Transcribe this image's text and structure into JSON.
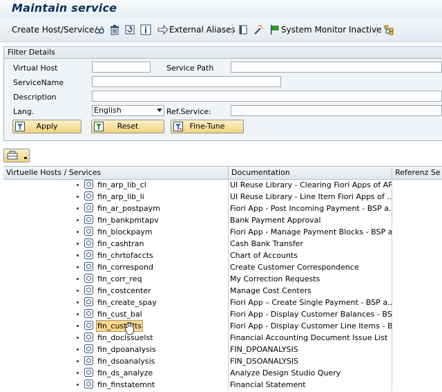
{
  "window": {
    "title": "Maintain service"
  },
  "toolbar": {
    "create_host_label": "Create Host/Service",
    "external_aliases_label": "External Aliases",
    "system_monitor_label": "System Monitor Inactive"
  },
  "filter": {
    "header": "Filter Details",
    "virtual_host_label": "Virtual Host",
    "virtual_host_value": "",
    "service_path_label": "Service Path",
    "service_path_value": "",
    "service_name_label": "ServiceName",
    "service_name_value": "",
    "description_label": "Description",
    "description_value": "",
    "lang_label": "Lang.",
    "lang_value": "English",
    "ref_service_label": "Ref.Service:",
    "ref_service_value": "",
    "apply_label": "Apply",
    "reset_label": "Reset",
    "fine_tune_label": "Fine-Tune"
  },
  "table": {
    "columns": [
      "Virtuelle Hosts / Services",
      "Documentation",
      "Referenz Se"
    ],
    "rows": [
      {
        "name": "fin_arp_lib_cl",
        "doc": "UI Reuse Library - Clearing Fiori Apps of AP..."
      },
      {
        "name": "fin_arp_lib_li",
        "doc": "UI Reuse Library - Line Item Fiori Apps of ..."
      },
      {
        "name": "fin_ar_postpaym",
        "doc": "Fiori App - Post Incoming Payment - BSP a..."
      },
      {
        "name": "fin_bankpmtapv",
        "doc": "Bank Payment Approval"
      },
      {
        "name": "fin_blockpaym",
        "doc": "Fiori App - Manage Payment Blocks - BSP a..."
      },
      {
        "name": "fin_cashtran",
        "doc": "Cash Bank Transfer"
      },
      {
        "name": "fin_chrtofaccts",
        "doc": "Chart of Accounts"
      },
      {
        "name": "fin_correspond",
        "doc": "Create Customer Correspondence"
      },
      {
        "name": "fin_corr_req",
        "doc": "My Correction Requests"
      },
      {
        "name": "fin_costcenter",
        "doc": "Manage Cost Centers"
      },
      {
        "name": "fin_create_spay",
        "doc": "Fiori App – Create Single Payment - BSP a..."
      },
      {
        "name": "fin_cust_bal",
        "doc": "Fiori App - Display Customer Balances - BSP..."
      },
      {
        "name": "fin_cust_lits",
        "doc": "Fiori App - Display Customer Line Items - B..."
      },
      {
        "name": "fin_docissuelst",
        "doc": "Financial Accounting Document Issue List"
      },
      {
        "name": "fin_dpoanalysis",
        "doc": "FIN_DPOANALYSIS"
      },
      {
        "name": "fin_dsoanalysis",
        "doc": "FIN_DSOANALYSIS"
      },
      {
        "name": "fin_ds_analyze",
        "doc": "Analyze Design Studio Query"
      },
      {
        "name": "fin_finstatemnt",
        "doc": "Financial Statement"
      }
    ]
  },
  "icons": [
    "glasses-icon",
    "trash-icon",
    "refresh-icon",
    "info-icon",
    "arrow-right-icon",
    "book-icon",
    "magic-wand-icon",
    "flag-icon",
    "hierarchy-icon",
    "filter-icon",
    "reset-icon",
    "fine-tune-icon",
    "layout-icon",
    "service-icon"
  ],
  "colors": {
    "title": "#0b2f5b",
    "button_bg": "#f3d27e",
    "selected_row": "#fbd98c",
    "flag_green": "#2e9a2e"
  }
}
